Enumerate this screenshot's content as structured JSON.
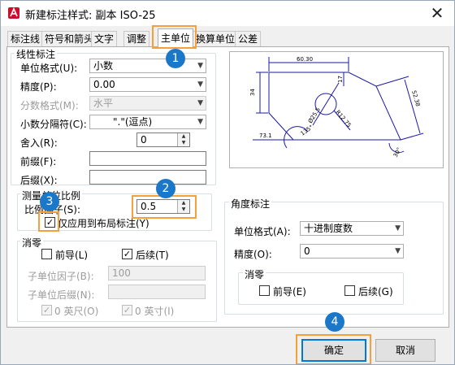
{
  "window": {
    "title": "新建标注样式: 副本 ISO-25",
    "close_glyph": "✕"
  },
  "tabs": [
    {
      "label": "标注线"
    },
    {
      "label": "符号和箭头"
    },
    {
      "label": "文字"
    },
    {
      "label": "调整"
    },
    {
      "label": "主单位"
    },
    {
      "label": "换算单位"
    },
    {
      "label": "公差"
    }
  ],
  "active_tab": "主单位",
  "linear": {
    "group_title": "线性标注",
    "unit_format_label": "单位格式(U):",
    "unit_format_value": "小数",
    "precision_label": "精度(P):",
    "precision_value": "0.00",
    "fraction_format_label": "分数格式(M):",
    "fraction_format_value": "水平",
    "decimal_sep_label": "小数分隔符(C):",
    "decimal_sep_value": "\".\"(逗点)",
    "roundoff_label": "舍入(R):",
    "roundoff_value": "0",
    "prefix_label": "前缀(F):",
    "prefix_value": "",
    "suffix_label": "后缀(X):",
    "suffix_value": ""
  },
  "scale": {
    "group_title": "测量单位比例",
    "factor_label": "比例因子(S):",
    "factor_value": "0.5",
    "layout_only_label": "仅应用到布局标注(Y)",
    "layout_only_checked": true
  },
  "zero_suppression": {
    "group_title": "消零",
    "leading_label": "前导(L)",
    "leading_checked": false,
    "trailing_label": "后续(T)",
    "trailing_checked": true,
    "sub_factor_label": "子单位因子(B):",
    "sub_factor_value": "100",
    "sub_suffix_label": "子单位后缀(N):",
    "sub_suffix_value": "",
    "feet_label": "0 英尺(O)",
    "inches_label": "0 英寸(I)"
  },
  "preview": {
    "dims": {
      "top": "60.30",
      "left": "34",
      "small": "17",
      "right": "52.38",
      "radius": "R12.75",
      "diameter": "Ø25.5",
      "angle": "135°",
      "bottom": "73.1",
      "bottom_right": "30°"
    }
  },
  "angular": {
    "group_title": "角度标注",
    "unit_format_label": "单位格式(A):",
    "unit_format_value": "十进制度数",
    "precision_label": "精度(O):",
    "precision_value": "0",
    "zero_title": "消零",
    "leading_label": "前导(E)",
    "leading_checked": false,
    "trailing_label": "后续(G)",
    "trailing_checked": false
  },
  "buttons": {
    "ok": "确定",
    "cancel": "取消"
  },
  "callouts": [
    "1",
    "2",
    "3",
    "4"
  ],
  "colors": {
    "callout": "#1b78c8",
    "highlight": "#f5a03a",
    "preview_line": "#1a1aa8",
    "default_button": "#0078d7"
  }
}
